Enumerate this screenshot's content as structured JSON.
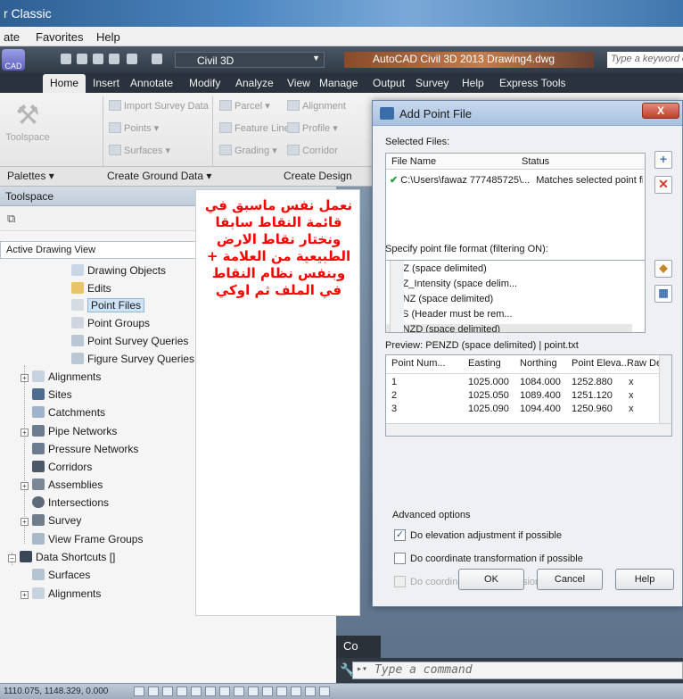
{
  "titlebar": {
    "title": "r Classic"
  },
  "menubar": {
    "items": [
      "ate",
      "Favorites",
      "Help"
    ]
  },
  "qat": {
    "app_label": "CAD",
    "workspace": "Civil 3D",
    "doc_title": "AutoCAD Civil 3D 2013   Drawing4.dwg",
    "search_placeholder": "Type a keyword or p"
  },
  "ribbon": {
    "tabs": [
      "Home",
      "Insert",
      "Annotate",
      "Modify",
      "Analyze",
      "View",
      "Manage",
      "Output",
      "Survey",
      "Help",
      "Express Tools"
    ],
    "toolspace_label": "Toolspace",
    "ground_items": [
      "Import Survey Data",
      "Points",
      "Surfaces"
    ],
    "design_items": [
      "Parcel",
      "Feature Line",
      "Grading"
    ],
    "design_items2": [
      "Alignment",
      "Profile",
      "Corridor"
    ],
    "panels": [
      "Palettes",
      "Create Ground Data",
      "Create Design"
    ]
  },
  "toolspace": {
    "header": "Toolspace",
    "view_combo": "Active Drawing View",
    "tree": [
      "Drawing Objects",
      "Edits",
      "Point Files",
      "Point Groups",
      "Point Survey Queries",
      "Figure Survey Queries",
      "Alignments",
      "Sites",
      "Catchments",
      "Pipe Networks",
      "Pressure Networks",
      "Corridors",
      "Assemblies",
      "Intersections",
      "Survey",
      "View Frame Groups",
      "Data Shortcuts []",
      "Surfaces",
      "Alignments"
    ]
  },
  "note": {
    "text": "نعمل نفس ماسبق في قائمة النقاط سابقا ونختار نقاط الارض الطبيعية من العلامة + وبنفس نظام النقاط في الملف ثم اوكي"
  },
  "dialog": {
    "title": "Add Point File",
    "selected_files_label": "Selected Files:",
    "files_cols": [
      "File Name",
      "Status"
    ],
    "file_row": {
      "name": "C:\\Users\\fawaz 777485725\\...",
      "status": "Matches selected point file for..."
    },
    "format_label": "Specify point file format (filtering ON):",
    "formats": [
      "NEZ (space delimited)",
      "XYZ_Intensity (space delim...",
      "PENZ (space delimited)",
      "PTS (Header must be rem...",
      "PENZD (space delimited)"
    ],
    "preview_label": "Preview: PENZD (space delimited) | point.txt",
    "preview_cols": [
      "Point Num...",
      "Easting",
      "Northing",
      "Point Eleva...",
      "Raw Desc"
    ],
    "preview_rows": [
      [
        "1",
        "1025.000",
        "1084.000",
        "1252.880",
        "x"
      ],
      [
        "2",
        "1025.050",
        "1089.400",
        "1251.120",
        "x"
      ],
      [
        "3",
        "1025.090",
        "1094.400",
        "1250.960",
        "x"
      ]
    ],
    "advanced_label": "Advanced options",
    "options": [
      {
        "label": "Do elevation adjustment if possible",
        "checked": "✓"
      },
      {
        "label": "Do coordinate transformation if possible",
        "checked": ""
      },
      {
        "label": "Do coordinate data expansion if possible",
        "checked": ""
      }
    ],
    "buttons": {
      "ok": "OK",
      "cancel": "Cancel",
      "help": "Help"
    },
    "close": "X"
  },
  "commandline": {
    "placeholder": "Type a command",
    "history_label": "Co"
  },
  "statusbar": {
    "coords": "1110.075, 1148.329, 0.000"
  },
  "colors": {
    "note_text": "#ff0000",
    "dialog_title_bg": "#b8cde8",
    "ribbon_tabs_bg": "#2a333d"
  }
}
